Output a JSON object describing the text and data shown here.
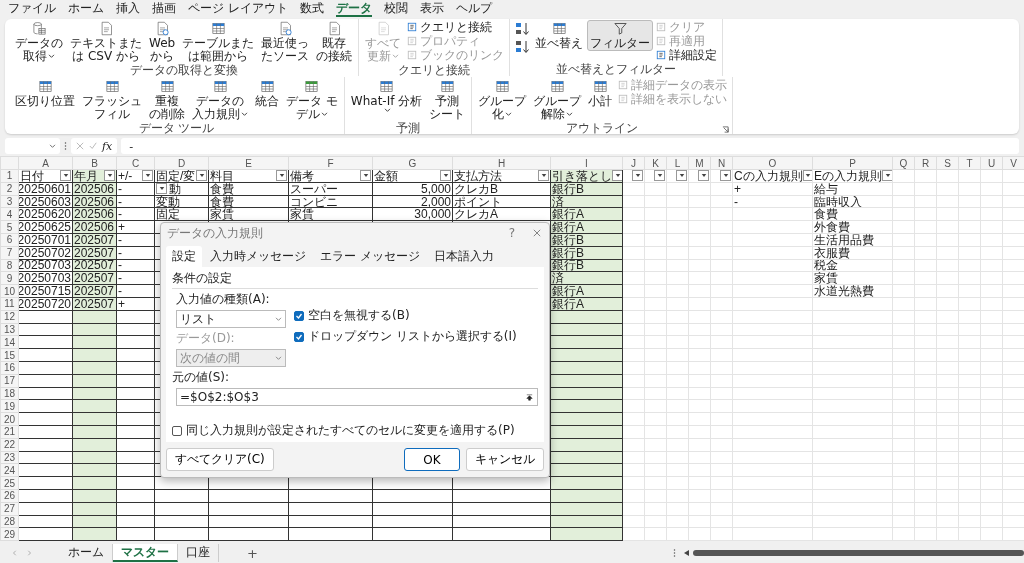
{
  "menu_tabs": [
    {
      "label": "ファイル",
      "selected": false
    },
    {
      "label": "ホーム",
      "selected": false
    },
    {
      "label": "挿入",
      "selected": false
    },
    {
      "label": "描画",
      "selected": false
    },
    {
      "label": "ページ レイアウト",
      "selected": false
    },
    {
      "label": "数式",
      "selected": false
    },
    {
      "label": "データ",
      "selected": true
    },
    {
      "label": "校閲",
      "selected": false
    },
    {
      "label": "表示",
      "selected": false
    },
    {
      "label": "ヘルプ",
      "selected": false
    }
  ],
  "ribbon": {
    "groups": [
      {
        "label": "データの取得と変換",
        "items": [
          {
            "kind": "large",
            "lines": [
              "データの",
              "取得"
            ],
            "dropdown": true,
            "disabled": false,
            "pressed": false
          },
          {
            "kind": "large",
            "lines": [
              "テキストまた",
              "は CSV から"
            ],
            "dropdown": false,
            "disabled": false,
            "pressed": false
          },
          {
            "kind": "large",
            "lines": [
              "Web",
              "から"
            ],
            "dropdown": false,
            "disabled": false,
            "pressed": false
          },
          {
            "kind": "large",
            "lines": [
              "テーブルまた",
              "は範囲から"
            ],
            "dropdown": false,
            "disabled": false,
            "pressed": false
          },
          {
            "kind": "large",
            "lines": [
              "最近使っ",
              "たソース"
            ],
            "dropdown": false,
            "disabled": false,
            "pressed": false
          },
          {
            "kind": "large",
            "lines": [
              "既存",
              "の接続"
            ],
            "dropdown": false,
            "disabled": false,
            "pressed": false
          }
        ]
      },
      {
        "label": "クエリと接続",
        "items": [
          {
            "kind": "large",
            "lines": [
              "すべて",
              "更新"
            ],
            "dropdown": true,
            "disabled": true,
            "pressed": false
          },
          {
            "kind": "stack",
            "items": [
              {
                "label": "クエリと接続",
                "disabled": false
              },
              {
                "label": "プロパティ",
                "disabled": true
              },
              {
                "label": "ブックのリンク",
                "disabled": true
              }
            ]
          }
        ]
      },
      {
        "label": "並べ替えとフィルター",
        "items": [
          {
            "kind": "sort_pair"
          },
          {
            "kind": "large",
            "lines": [
              "並べ替え"
            ],
            "dropdown": false,
            "disabled": false,
            "pressed": false
          },
          {
            "kind": "large",
            "lines": [
              "フィルター"
            ],
            "dropdown": false,
            "disabled": false,
            "pressed": true
          },
          {
            "kind": "stack",
            "items": [
              {
                "label": "クリア",
                "disabled": true
              },
              {
                "label": "再適用",
                "disabled": true
              },
              {
                "label": "詳細設定",
                "disabled": false
              }
            ]
          }
        ]
      },
      {
        "label": "データ ツール",
        "items": [
          {
            "kind": "large",
            "lines": [
              "区切り位置"
            ],
            "dropdown": false,
            "disabled": false,
            "pressed": false
          },
          {
            "kind": "large",
            "lines": [
              "フラッシュ",
              "フィル"
            ],
            "dropdown": false,
            "disabled": false,
            "pressed": false
          },
          {
            "kind": "large",
            "lines": [
              "重複",
              "の削除"
            ],
            "dropdown": false,
            "disabled": false,
            "pressed": false
          },
          {
            "kind": "large",
            "lines": [
              "データの",
              "入力規則"
            ],
            "dropdown": true,
            "disabled": false,
            "pressed": false
          },
          {
            "kind": "large",
            "lines": [
              "統合"
            ],
            "dropdown": false,
            "disabled": false,
            "pressed": false
          },
          {
            "kind": "large",
            "lines": [
              "データ モ",
              "デル"
            ],
            "dropdown": true,
            "disabled": false,
            "pressed": false
          }
        ]
      },
      {
        "label": "予測",
        "items": [
          {
            "kind": "large",
            "lines": [
              "What-If 分析"
            ],
            "dropdown": true,
            "disabled": false,
            "pressed": false
          },
          {
            "kind": "large",
            "lines": [
              "予測",
              "シート"
            ],
            "dropdown": false,
            "disabled": false,
            "pressed": false
          }
        ]
      },
      {
        "label": "アウトライン",
        "launcher": true,
        "items": [
          {
            "kind": "large",
            "lines": [
              "グループ",
              "化"
            ],
            "dropdown": true,
            "disabled": false,
            "pressed": false
          },
          {
            "kind": "large",
            "lines": [
              "グループ",
              "解除"
            ],
            "dropdown": true,
            "disabled": false,
            "pressed": false
          },
          {
            "kind": "large",
            "lines": [
              "小計"
            ],
            "dropdown": false,
            "disabled": false,
            "pressed": false
          },
          {
            "kind": "stack",
            "items": [
              {
                "label": "詳細データの表示",
                "disabled": true
              },
              {
                "label": "詳細を表示しない",
                "disabled": true
              }
            ]
          }
        ]
      }
    ]
  },
  "formula_bar": {
    "fx": "fx",
    "value": "-"
  },
  "sheet": {
    "columns": [
      {
        "label": "A",
        "filter": true,
        "bordered": true,
        "highlighted": false,
        "numeric": true
      },
      {
        "label": "B",
        "filter": true,
        "bordered": true,
        "highlighted": true,
        "numeric": false
      },
      {
        "label": "C",
        "filter": true,
        "bordered": true,
        "highlighted": false,
        "numeric": false
      },
      {
        "label": "D",
        "filter": true,
        "bordered": true,
        "highlighted": false,
        "numeric": false
      },
      {
        "label": "E",
        "filter": true,
        "bordered": true,
        "highlighted": false,
        "numeric": false
      },
      {
        "label": "F",
        "filter": true,
        "bordered": true,
        "highlighted": false,
        "numeric": false
      },
      {
        "label": "G",
        "filter": true,
        "bordered": true,
        "highlighted": false,
        "numeric": true
      },
      {
        "label": "H",
        "filter": true,
        "bordered": true,
        "highlighted": false,
        "numeric": false
      },
      {
        "label": "I",
        "filter": true,
        "bordered": true,
        "highlighted": true,
        "numeric": false
      },
      {
        "label": "J",
        "filter": true,
        "bordered": false,
        "highlighted": false,
        "numeric": false
      },
      {
        "label": "K",
        "filter": true,
        "bordered": false,
        "highlighted": false,
        "numeric": false
      },
      {
        "label": "L",
        "filter": true,
        "bordered": false,
        "highlighted": false,
        "numeric": false
      },
      {
        "label": "M",
        "filter": true,
        "bordered": false,
        "highlighted": false,
        "numeric": false
      },
      {
        "label": "N",
        "filter": true,
        "bordered": false,
        "highlighted": false,
        "numeric": false
      },
      {
        "label": "O",
        "filter": true,
        "bordered": false,
        "highlighted": false,
        "numeric": false
      },
      {
        "label": "P",
        "filter": true,
        "bordered": false,
        "highlighted": false,
        "numeric": false
      },
      {
        "label": "Q",
        "filter": false,
        "bordered": false,
        "highlighted": false
      },
      {
        "label": "R",
        "filter": false,
        "bordered": false,
        "highlighted": false
      },
      {
        "label": "S",
        "filter": false,
        "bordered": false,
        "highlighted": false
      },
      {
        "label": "T",
        "filter": false,
        "bordered": false,
        "highlighted": false
      },
      {
        "label": "U",
        "filter": false,
        "bordered": false,
        "highlighted": false
      },
      {
        "label": "V",
        "filter": false,
        "bordered": false,
        "highlighted": false
      }
    ],
    "rows": [
      {
        "label": "1",
        "header": true,
        "cells": [
          "日付",
          "年月",
          "+/-",
          "固定/変",
          "料目",
          "備考",
          "金額",
          "支払方法",
          "引き落とし",
          null,
          null,
          null,
          null,
          null,
          "Cの入力規則",
          "Eの入力規則"
        ]
      },
      {
        "label": "2",
        "cells": [
          "20250601",
          "202506",
          "-",
          {
            "text": "動",
            "list_button": true
          },
          "食費",
          "スーパー",
          "5,000",
          "クレカB",
          "銀行B",
          null,
          null,
          null,
          null,
          null,
          "+",
          "給与"
        ]
      },
      {
        "label": "3",
        "cells": [
          "20250603",
          "202506",
          "-",
          "変動",
          "食費",
          "コンビニ",
          "2,000",
          "ポイント",
          "済",
          null,
          null,
          null,
          null,
          null,
          "-",
          "臨時収入"
        ]
      },
      {
        "label": "4",
        "cells": [
          "20250620",
          "202506",
          "-",
          "固定",
          "家賃",
          "家賃",
          "30,000",
          "クレカA",
          "銀行A",
          null,
          null,
          null,
          null,
          null,
          null,
          "食費"
        ]
      },
      {
        "label": "5",
        "cells": [
          "20250625",
          "202506",
          "+",
          null,
          null,
          null,
          null,
          null,
          "銀行A",
          null,
          null,
          null,
          null,
          null,
          null,
          "外食費"
        ]
      },
      {
        "label": "6",
        "cells": [
          "20250701",
          "202507",
          "-",
          null,
          null,
          null,
          null,
          null,
          "銀行B",
          null,
          null,
          null,
          null,
          null,
          null,
          "生活用品費"
        ]
      },
      {
        "label": "7",
        "cells": [
          "20250702",
          "202507",
          "-",
          null,
          null,
          null,
          null,
          null,
          "銀行B",
          null,
          null,
          null,
          null,
          null,
          null,
          "衣服費"
        ]
      },
      {
        "label": "8",
        "cells": [
          "20250703",
          "202507",
          "-",
          null,
          null,
          null,
          null,
          null,
          "銀行B",
          null,
          null,
          null,
          null,
          null,
          null,
          "税金"
        ]
      },
      {
        "label": "9",
        "cells": [
          "20250703",
          "202507",
          "-",
          null,
          null,
          null,
          null,
          null,
          "済",
          null,
          null,
          null,
          null,
          null,
          null,
          "家賃"
        ]
      },
      {
        "label": "10",
        "cells": [
          "20250715",
          "202507",
          "-",
          null,
          null,
          null,
          null,
          null,
          "銀行A",
          null,
          null,
          null,
          null,
          null,
          null,
          "水道光熱費"
        ]
      },
      {
        "label": "11",
        "cells": [
          "20250720",
          "202507",
          "+",
          null,
          null,
          null,
          null,
          null,
          "銀行A"
        ]
      },
      {
        "label": "12"
      },
      {
        "label": "13"
      },
      {
        "label": "14"
      },
      {
        "label": "15"
      },
      {
        "label": "16"
      },
      {
        "label": "17"
      },
      {
        "label": "18"
      },
      {
        "label": "19"
      },
      {
        "label": "20"
      },
      {
        "label": "21"
      },
      {
        "label": "22"
      },
      {
        "label": "23"
      },
      {
        "label": "24"
      },
      {
        "label": "25"
      },
      {
        "label": "26"
      },
      {
        "label": "27"
      },
      {
        "label": "28"
      },
      {
        "label": "29"
      }
    ]
  },
  "dialog": {
    "title": "データの入力規則",
    "help": "?",
    "tabs": [
      {
        "label": "設定",
        "selected": true
      },
      {
        "label": "入力時メッセージ",
        "selected": false
      },
      {
        "label": "エラー メッセージ",
        "selected": false
      },
      {
        "label": "日本語入力",
        "selected": false
      }
    ],
    "section": "条件の設定",
    "type_label": "入力値の種類(A):",
    "type_value": "リスト",
    "checkboxes": [
      {
        "label": "空白を無視する(B)",
        "checked": true
      },
      {
        "label": "ドロップダウン リストから選択する(I)",
        "checked": true
      }
    ],
    "data_label": "データ(D):",
    "data_value": "次の値の間",
    "data_disabled": true,
    "source_label": "元の値(S):",
    "source_value": "=$O$2:$O$3",
    "apply_all": {
      "label": "同じ入力規則が設定されたすべてのセルに変更を適用する(P)",
      "checked": false
    },
    "buttons": [
      {
        "label": "すべてクリア(C)",
        "kind": "left",
        "default": false
      },
      {
        "label": "OK",
        "kind": "right",
        "default": true
      },
      {
        "label": "キャンセル",
        "kind": "right",
        "default": false
      }
    ]
  },
  "sheet_tabs": [
    {
      "label": "ホーム",
      "selected": false
    },
    {
      "label": "マスター",
      "selected": true
    },
    {
      "label": "口座",
      "selected": false
    }
  ],
  "add_sheet": "+"
}
